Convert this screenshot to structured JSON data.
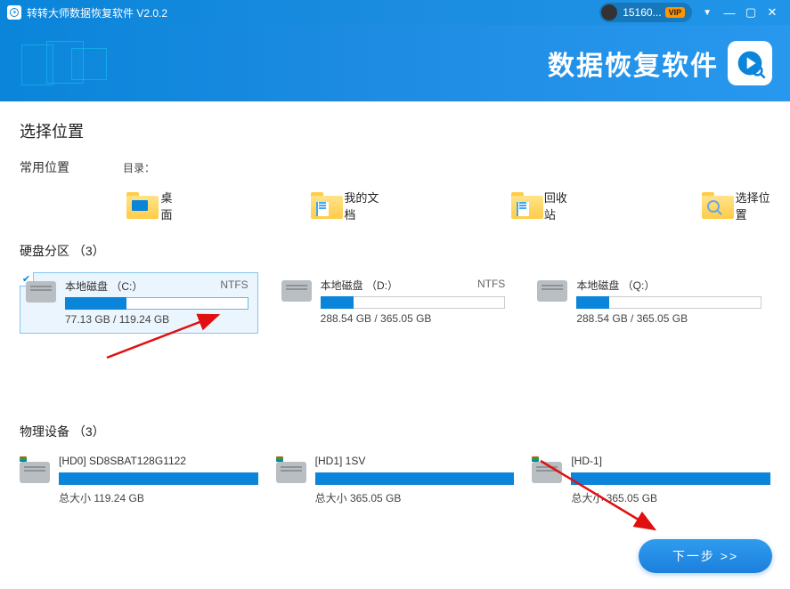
{
  "titlebar": {
    "app_title": "转转大师数据恢复软件 V2.0.2",
    "user_id": "15160...",
    "vip_label": "VIP"
  },
  "banner": {
    "title": "数据恢复软件"
  },
  "sections": {
    "select_location": "选择位置",
    "common_locations_label": "常用位置",
    "directory_label": "目录：",
    "partitions_label": "硬盘分区 （3）",
    "physical_devices_label": "物理设备 （3）"
  },
  "locations": {
    "desktop": "桌面",
    "documents": "我的文档",
    "recycle": "回收站",
    "choose": "选择位置"
  },
  "partitions": [
    {
      "name": "本地磁盘 （C:）",
      "fs": "NTFS",
      "size": "77.13 GB / 119.24 GB",
      "fillPct": 34,
      "selected": true
    },
    {
      "name": "本地磁盘 （D:）",
      "fs": "NTFS",
      "size": "288.54 GB / 365.05 GB",
      "fillPct": 18,
      "selected": false
    },
    {
      "name": "本地磁盘 （Q:）",
      "fs": "",
      "size": "288.54 GB / 365.05 GB",
      "fillPct": 18,
      "selected": false
    }
  ],
  "physical": [
    {
      "name": "[HD0] SD8SBAT128G1122",
      "size": "总大小 119.24 GB"
    },
    {
      "name": "[HD1] 1SV",
      "size": "总大小 365.05 GB"
    },
    {
      "name": "[HD-1]",
      "size": "总大小 365.05 GB"
    }
  ],
  "footer": {
    "next_label": "下一步 >>"
  }
}
